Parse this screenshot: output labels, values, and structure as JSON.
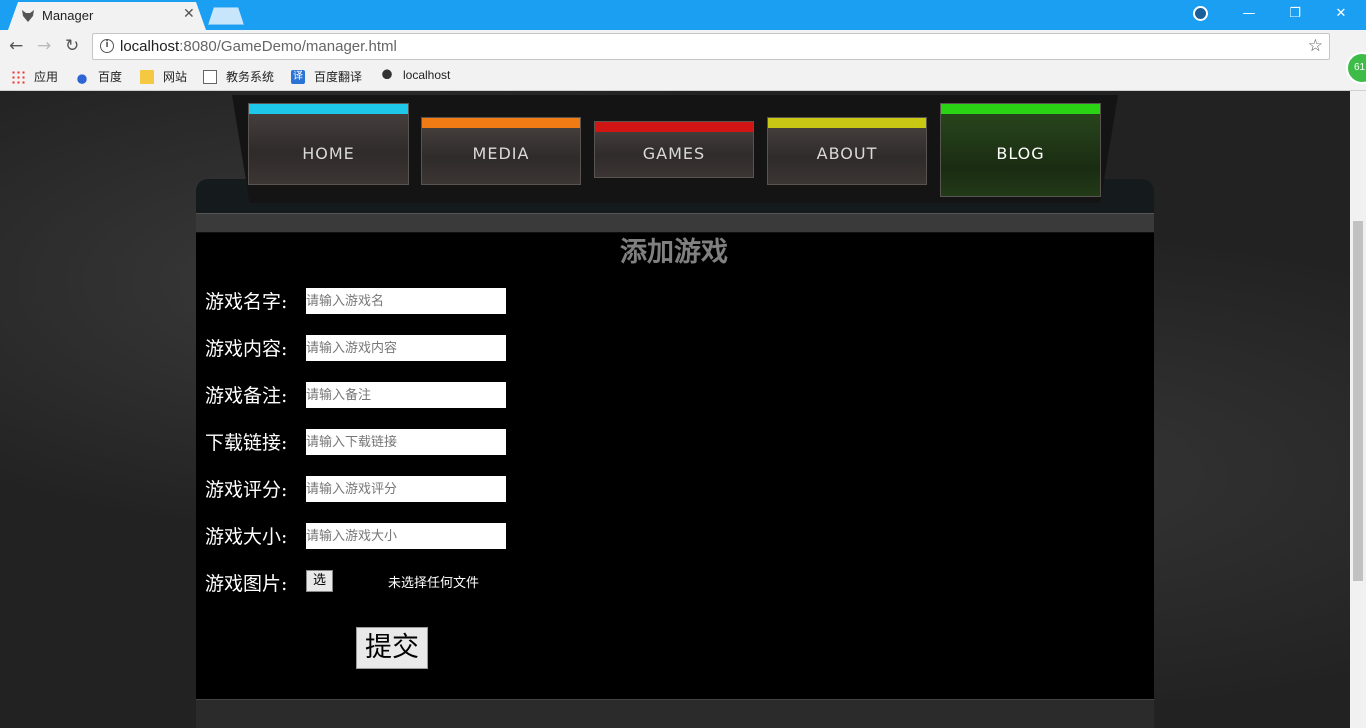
{
  "browser": {
    "tab_title": "Manager",
    "url_host": "localhost",
    "url_path": ":8080/GameDemo/manager.html",
    "bookmarks": [
      {
        "label": "应用",
        "icon": "apps-grid-icon"
      },
      {
        "label": "百度",
        "icon": "baidu-paw-icon"
      },
      {
        "label": "网站",
        "icon": "folder-icon"
      },
      {
        "label": "教务系统",
        "icon": "page-icon"
      },
      {
        "label": "百度翻译",
        "icon": "translate-icon"
      },
      {
        "label": "localhost",
        "icon": "wolf-icon"
      }
    ],
    "translate_glyph": "译",
    "extension_badge": "61"
  },
  "nav": {
    "items": [
      {
        "label": "HOME",
        "color": "#1ec8e8"
      },
      {
        "label": "MEDIA",
        "color": "#f07a14"
      },
      {
        "label": "GAMES",
        "color": "#d11414"
      },
      {
        "label": "ABOUT",
        "color": "#c8c814"
      },
      {
        "label": "BLOG",
        "color": "#2ad414"
      }
    ],
    "active": "BLOG"
  },
  "form": {
    "title": "添加游戏",
    "fields": [
      {
        "label": "游戏名字:",
        "placeholder": "请输入游戏名"
      },
      {
        "label": "游戏内容:",
        "placeholder": "请输入游戏内容"
      },
      {
        "label": "游戏备注:",
        "placeholder": "请输入备注"
      },
      {
        "label": "下载链接:",
        "placeholder": "请输入下载链接"
      },
      {
        "label": "游戏评分:",
        "placeholder": "请输入游戏评分"
      },
      {
        "label": "游戏大小:",
        "placeholder": "请输入游戏大小"
      }
    ],
    "image_label": "游戏图片:",
    "file_button": "选择文件",
    "file_status": "未选择任何文件",
    "submit": "提交"
  }
}
